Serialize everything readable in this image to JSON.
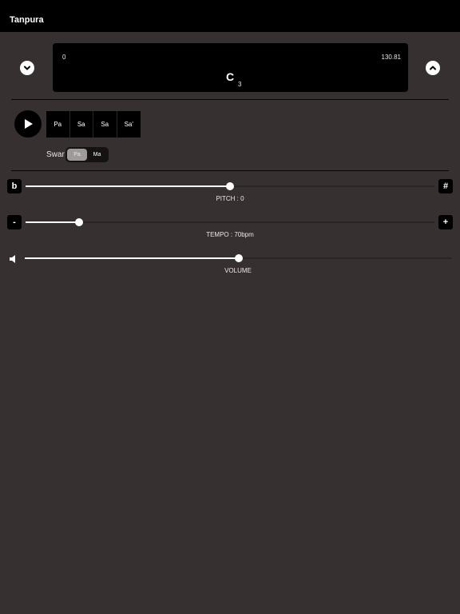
{
  "app": {
    "title": "Tanpura"
  },
  "display": {
    "range_min": "0",
    "range_max": "130.81",
    "note": "C",
    "octave": "3"
  },
  "icons": {
    "down": "chevron-down-icon",
    "up": "chevron-up-icon",
    "play": "play-icon",
    "volume": "speaker-icon"
  },
  "strings": [
    "Pa",
    "Sa",
    "Sa",
    "Sa'"
  ],
  "swar": {
    "label": "Swar",
    "options": [
      "Pa",
      "Ma"
    ],
    "selected": "Pa"
  },
  "pitch": {
    "decrease_label": "b",
    "increase_label": "#",
    "caption": "PITCH : 0",
    "level": 0.5
  },
  "tempo": {
    "decrease_label": "-",
    "increase_label": "+",
    "caption": "TEMPO : 70bpm",
    "level": 0.13
  },
  "volume": {
    "caption": "VOLUME",
    "level": 0.5
  },
  "colors": {
    "background": "#363030",
    "bar": "#000000",
    "accent": "#ffffff"
  }
}
